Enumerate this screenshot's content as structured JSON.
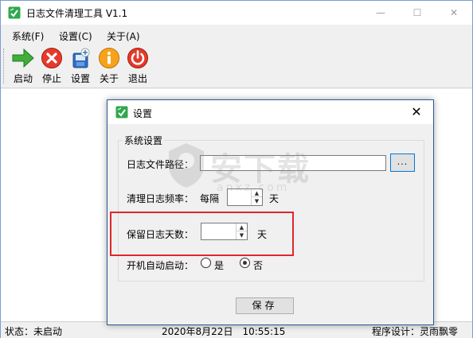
{
  "window": {
    "title": "日志文件清理工具 V1.1",
    "minimize": "—",
    "maximize": "☐",
    "close": "✕"
  },
  "menu": {
    "items": [
      {
        "label": "系统(F)"
      },
      {
        "label": "设置(C)"
      },
      {
        "label": "关于(A)"
      }
    ]
  },
  "toolbar": {
    "buttons": [
      {
        "label": "启动",
        "icon": "start-arrow-icon"
      },
      {
        "label": "停止",
        "icon": "stop-x-icon"
      },
      {
        "label": "设置",
        "icon": "settings-icon"
      },
      {
        "label": "关于",
        "icon": "info-icon"
      },
      {
        "label": "退出",
        "icon": "power-icon"
      }
    ]
  },
  "statusbar": {
    "status": "状态：未启动",
    "datetime": "2020年8月22日　10:55:15",
    "designer": "程序设计：灵雨飘零"
  },
  "dialog": {
    "title": "设置",
    "close": "✕",
    "group_title": "系统设置",
    "log_path_label": "日志文件路径：",
    "log_path_value": "",
    "browse_label": "...",
    "clean_freq_label": "清理日志频率：",
    "every_label": "每隔",
    "freq_value": "",
    "day_unit": "天",
    "keep_days_label": "保留日志天数：",
    "keep_days_value": "",
    "keep_day_unit": "天",
    "autostart_label": "开机自动启动：",
    "radio_yes": "是",
    "radio_no": "否",
    "autostart_selected": "否",
    "save_label": "保存"
  },
  "watermark": {
    "text": "安下载",
    "sub": "anxz.com"
  },
  "colors": {
    "accent": "#0078d7",
    "highlight": "#e0262b",
    "dialog_border": "#2b579a"
  }
}
